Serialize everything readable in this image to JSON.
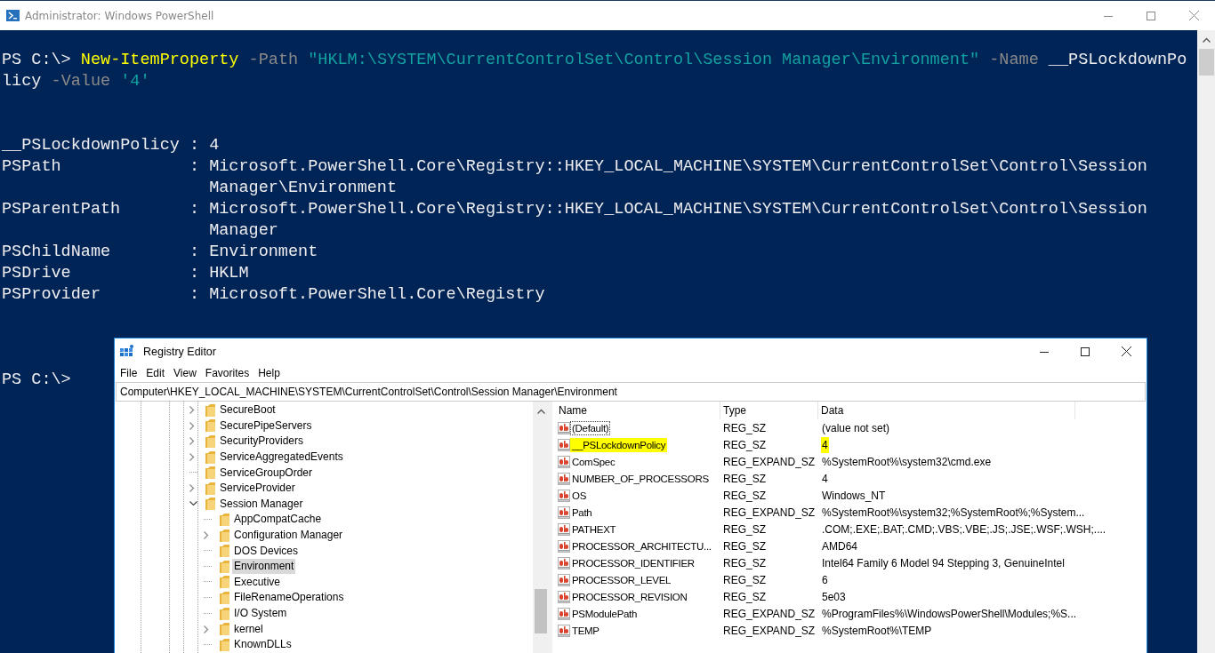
{
  "powershell": {
    "title": "Administrator: Windows PowerShell",
    "command_lines": [
      [
        {
          "text": "PS C:\\> ",
          "kind": "prompt"
        },
        {
          "text": "New-ItemProperty",
          "kind": "command"
        },
        {
          "text": " -Path",
          "kind": "param"
        },
        {
          "text": " \"HKLM:\\SYSTEM\\CurrentControlSet\\Control\\Session Manager\\Environment\"",
          "kind": "string"
        },
        {
          "text": " -Name",
          "kind": "param"
        },
        {
          "text": " __PSLockdownPo",
          "kind": "plain"
        }
      ],
      [
        {
          "text": "licy",
          "kind": "plain"
        },
        {
          "text": " -Value",
          "kind": "param"
        },
        {
          "text": " '4'",
          "kind": "string"
        }
      ]
    ],
    "output": [
      {
        "name": "__PSLockdownPolicy",
        "separator": ":",
        "value_lines": [
          "4"
        ]
      },
      {
        "name": "PSPath",
        "separator": ":",
        "value_lines": [
          "Microsoft.PowerShell.Core\\Registry::HKEY_LOCAL_MACHINE\\SYSTEM\\CurrentControlSet\\Control\\Session",
          "Manager\\Environment"
        ]
      },
      {
        "name": "PSParentPath",
        "separator": ":",
        "value_lines": [
          "Microsoft.PowerShell.Core\\Registry::HKEY_LOCAL_MACHINE\\SYSTEM\\CurrentControlSet\\Control\\Session",
          "Manager"
        ]
      },
      {
        "name": "PSChildName",
        "separator": ":",
        "value_lines": [
          "Environment"
        ]
      },
      {
        "name": "PSDrive",
        "separator": ":",
        "value_lines": [
          "HKLM"
        ]
      },
      {
        "name": "PSProvider",
        "separator": ":",
        "value_lines": [
          "Microsoft.PowerShell.Core\\Registry"
        ]
      }
    ],
    "prompt": "PS C:\\>"
  },
  "registry": {
    "title": "Registry Editor",
    "menu": [
      "File",
      "Edit",
      "View",
      "Favorites",
      "Help"
    ],
    "address": "Computer\\HKEY_LOCAL_MACHINE\\SYSTEM\\CurrentControlSet\\Control\\Session Manager\\Environment",
    "tree": [
      {
        "label": "SecureBoot",
        "expanded": false,
        "selected": false
      },
      {
        "label": "SecurePipeServers",
        "expanded": false,
        "selected": false
      },
      {
        "label": "SecurityProviders",
        "expanded": false,
        "selected": false
      },
      {
        "label": "ServiceAggregatedEvents",
        "expanded": false,
        "selected": false
      },
      {
        "label": "ServiceGroupOrder",
        "selected": false
      },
      {
        "label": "ServiceProvider",
        "expanded": false,
        "selected": false
      },
      {
        "label": "Session Manager",
        "expanded": true,
        "selected": false,
        "children": [
          {
            "label": "AppCompatCache",
            "selected": false
          },
          {
            "label": "Configuration Manager",
            "expanded": false,
            "selected": false
          },
          {
            "label": "DOS Devices",
            "selected": false
          },
          {
            "label": "Environment",
            "selected": true
          },
          {
            "label": "Executive",
            "selected": false
          },
          {
            "label": "FileRenameOperations",
            "selected": false
          },
          {
            "label": "I/O System",
            "selected": false
          },
          {
            "label": "kernel",
            "expanded": false,
            "selected": false
          },
          {
            "label": "KnownDLLs",
            "selected": false
          }
        ]
      }
    ],
    "columns": [
      "Name",
      "Type",
      "Data"
    ],
    "values": [
      {
        "name": "(Default)",
        "type": "REG_SZ",
        "data": "(value not set)",
        "highlighted": false,
        "focused": true
      },
      {
        "name": "__PSLockdownPolicy",
        "type": "REG_SZ",
        "data": "4",
        "highlighted": true,
        "focused": false
      },
      {
        "name": "ComSpec",
        "type": "REG_EXPAND_SZ",
        "data": "%SystemRoot%\\system32\\cmd.exe",
        "highlighted": false,
        "focused": false
      },
      {
        "name": "NUMBER_OF_PROCESSORS",
        "type": "REG_SZ",
        "data": "4",
        "highlighted": false,
        "focused": false
      },
      {
        "name": "OS",
        "type": "REG_SZ",
        "data": "Windows_NT",
        "highlighted": false,
        "focused": false
      },
      {
        "name": "Path",
        "type": "REG_EXPAND_SZ",
        "data": "%SystemRoot%\\system32;%SystemRoot%;%System...",
        "highlighted": false,
        "focused": false
      },
      {
        "name": "PATHEXT",
        "type": "REG_SZ",
        "data": ".COM;.EXE;.BAT;.CMD;.VBS;.VBE;.JS;.JSE;.WSF;.WSH;....",
        "highlighted": false,
        "focused": false
      },
      {
        "name": "PROCESSOR_ARCHITECTU...",
        "type": "REG_SZ",
        "data": "AMD64",
        "highlighted": false,
        "focused": false
      },
      {
        "name": "PROCESSOR_IDENTIFIER",
        "type": "REG_SZ",
        "data": "Intel64 Family 6 Model 94 Stepping 3, GenuineIntel",
        "highlighted": false,
        "focused": false
      },
      {
        "name": "PROCESSOR_LEVEL",
        "type": "REG_SZ",
        "data": "6",
        "highlighted": false,
        "focused": false
      },
      {
        "name": "PROCESSOR_REVISION",
        "type": "REG_SZ",
        "data": "5e03",
        "highlighted": false,
        "focused": false
      },
      {
        "name": "PSModulePath",
        "type": "REG_EXPAND_SZ",
        "data": "%ProgramFiles%\\WindowsPowerShell\\Modules;%S...",
        "highlighted": false,
        "focused": false
      },
      {
        "name": "TEMP",
        "type": "REG_EXPAND_SZ",
        "data": "%SystemRoot%\\TEMP",
        "highlighted": false,
        "focused": false
      }
    ]
  }
}
